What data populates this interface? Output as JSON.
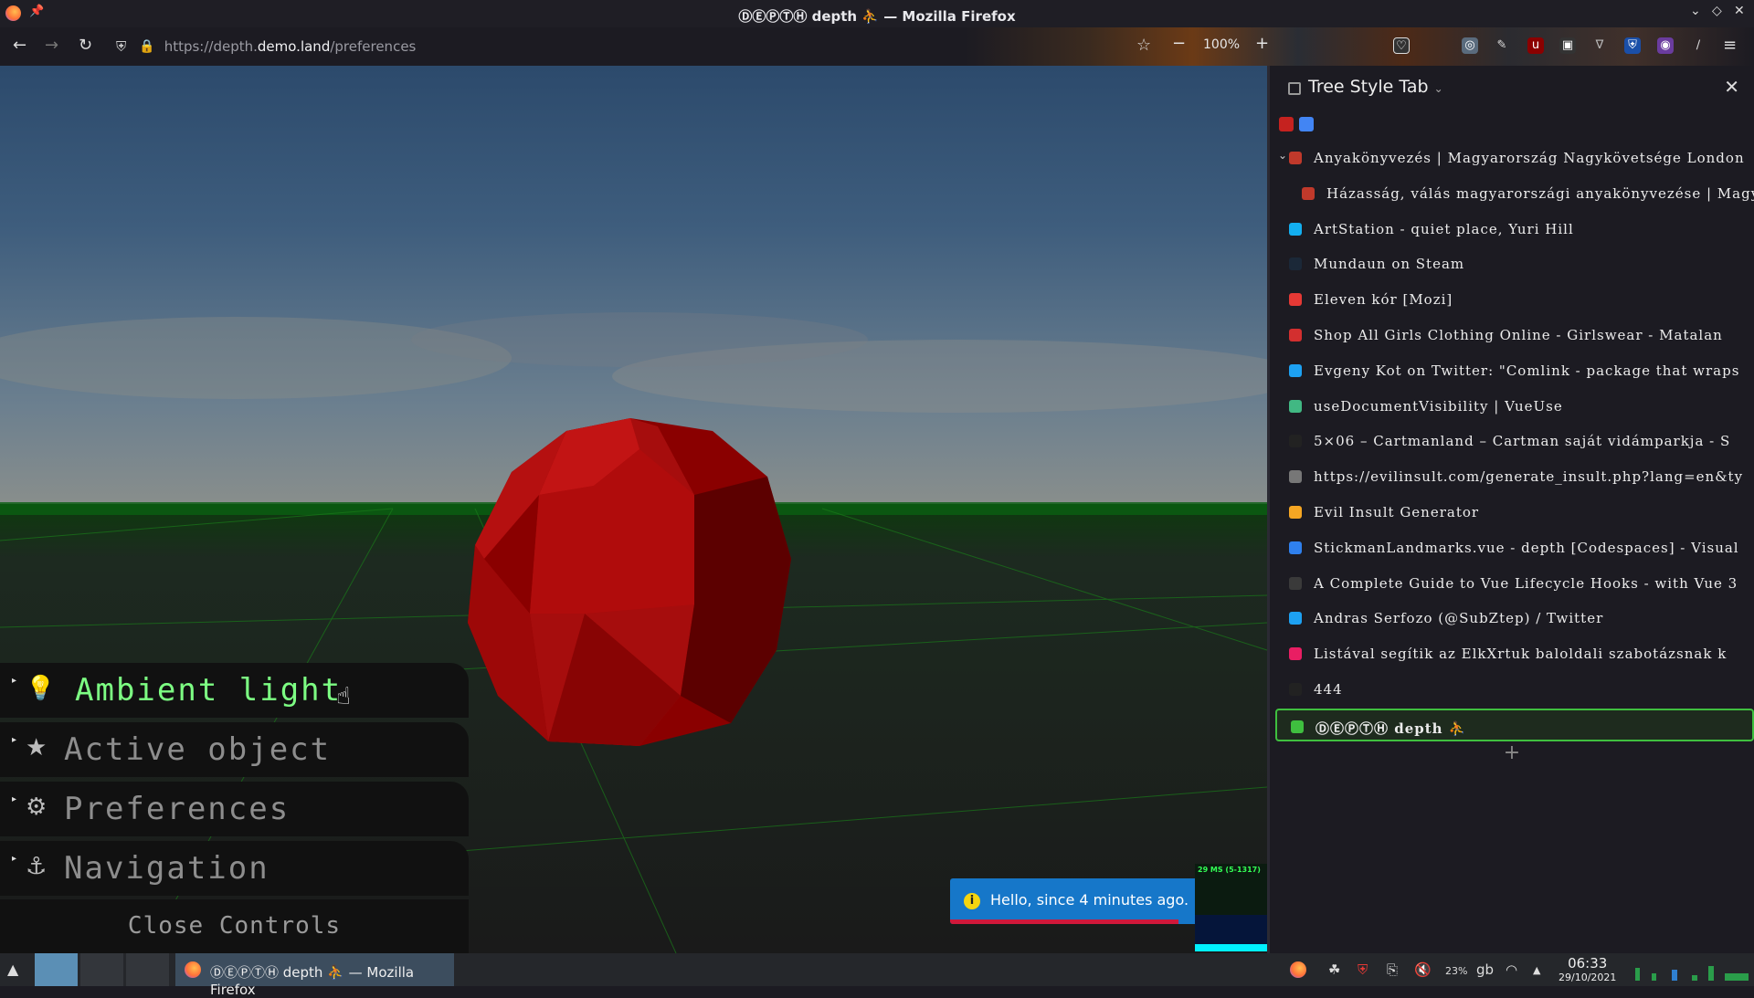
{
  "window": {
    "title": "ⒹⒺⓅⓉⒽ depth ⛹ — Mozilla Firefox"
  },
  "navbar": {
    "url_prefix": "https://depth.",
    "url_domain": "demo.land",
    "url_path": "/preferences",
    "zoom": "100%",
    "zoom_minus": "−",
    "zoom_plus": "+"
  },
  "controls": {
    "items": [
      {
        "label": "Ambient light",
        "icon": "lightbulb-icon",
        "active": true
      },
      {
        "label": "Active object",
        "icon": "star-icon",
        "active": false
      },
      {
        "label": "Preferences",
        "icon": "gear-icon",
        "active": false
      },
      {
        "label": "Navigation",
        "icon": "anchor-icon",
        "active": false
      }
    ],
    "close_label": "Close Controls"
  },
  "toast": {
    "message": "Hello, since 4 minutes ago.",
    "info_glyph": "i"
  },
  "stats": {
    "label": "29 MS (5-1317)"
  },
  "sidebar": {
    "title": "Tree Style Tab",
    "new_tab": "+",
    "tabs": [
      {
        "title": "Anyakönyvezés | Magyarország Nagykövetsége London",
        "level": 0,
        "twisty": "⌄",
        "fav_color": "#c0392b"
      },
      {
        "title": "Házasság, válás magyarországi anyakönyvezése | Magy",
        "level": 1,
        "fav_color": "#c0392b"
      },
      {
        "title": "ArtStation - quiet place, Yuri Hill",
        "level": 0,
        "fav_color": "#13aff0"
      },
      {
        "title": "Mundaun on Steam",
        "level": 0,
        "fav_color": "#1b2838"
      },
      {
        "title": "Eleven kór [Mozi]",
        "level": 0,
        "fav_color": "#e53935"
      },
      {
        "title": "Shop All Girls Clothing Online - Girlswear - Matalan",
        "level": 0,
        "fav_color": "#d32f2f"
      },
      {
        "title": "Evgeny Kot on Twitter: \"Comlink - package that wraps",
        "level": 0,
        "fav_color": "#1da1f2"
      },
      {
        "title": "useDocumentVisibility | VueUse",
        "level": 0,
        "fav_color": "#41b883"
      },
      {
        "title": "5×06 – Cartmanland – Cartman saját vidámparkja - S",
        "level": 0,
        "fav_color": "#222222"
      },
      {
        "title": "https://evilinsult.com/generate_insult.php?lang=en&ty",
        "level": 0,
        "fav_color": "#777777"
      },
      {
        "title": "Evil Insult Generator",
        "level": 0,
        "fav_color": "#f5a623"
      },
      {
        "title": "StickmanLandmarks.vue - depth [Codespaces] - Visual",
        "level": 0,
        "fav_color": "#2f80ed"
      },
      {
        "title": "A Complete Guide to Vue Lifecycle Hooks - with Vue 3",
        "level": 0,
        "fav_color": "#3a3a3a"
      },
      {
        "title": "Andras Serfozo (@SubZtep) / Twitter",
        "level": 0,
        "fav_color": "#1da1f2"
      },
      {
        "title": "Listával segítik az ElkXrtuk baloldali szabotázsnak k",
        "level": 0,
        "fav_color": "#e91e63"
      },
      {
        "title": "444",
        "level": 0,
        "fav_color": "#222222"
      },
      {
        "title": "ⒹⒺⓅⓉⒽ depth ⛹",
        "level": 0,
        "fav_color": "#3fbf3f",
        "active": true
      }
    ]
  },
  "taskbar": {
    "task_title": "ⒹⒺⓅⓉⒽ depth ⛹ — Mozilla Firefox",
    "battery": "23%",
    "keyboard": "gb",
    "time": "06:33",
    "date": "29/10/2021"
  },
  "colors": {
    "accent_green": "#7dff83",
    "toast_blue": "#1677c9",
    "sphere_red": "#b30000"
  }
}
